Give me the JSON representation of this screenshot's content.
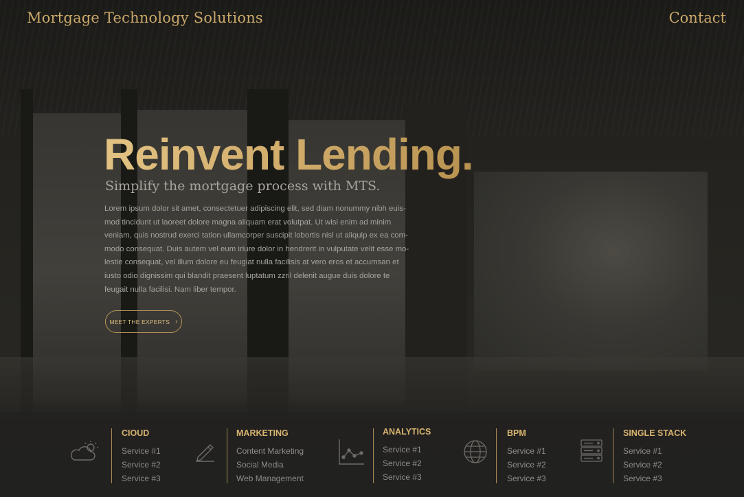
{
  "header": {
    "brand": "Mortgage Technology Solutions",
    "contact_label": "Contact"
  },
  "hero": {
    "headline": "Reinvent Lending.",
    "subhead": "Simplify the mortgage process with MTS.",
    "body": "Lorem ipsum dolor sit amet, consectetuer adipiscing elit, sed diam nonummy nibh euis-mod tincidunt ut laoreet dolore magna aliquam erat volutpat. Ut wisi enim ad minim veniam, quis nostrud exerci tation ullamcorper suscipit lobortis nisl ut aliquip ex ea com-modo consequat. Duis autem vel eum iriure dolor in hendrerit in vulputate velit esse mo-lestie consequat, vel illum dolore eu feugiat nulla facilisis at vero eros et accumsan et iusto odio dignissim qui blandit praesent luptatum zzril delenit augue duis dolore te feugait nulla facilisi. Nam liber tempor.",
    "cta_label": "MEET THE EXPERTS",
    "cta_icon": "chevron-right-icon"
  },
  "services": [
    {
      "title": "CIOUD",
      "icon": "cloud-sun-icon",
      "items": [
        "Service #1",
        "Service #2",
        "Service #3"
      ]
    },
    {
      "title": "MARKETING",
      "icon": "pen-icon",
      "items": [
        "Content Marketing",
        "Social Media",
        "Web Management"
      ]
    },
    {
      "title": "ANALYTICS",
      "icon": "line-chart-icon",
      "items": [
        "Service #1",
        "Service #2",
        "Service #3"
      ]
    },
    {
      "title": "BPM",
      "icon": "globe-icon",
      "items": [
        "Service #1",
        "Service #2",
        "Service #3"
      ]
    },
    {
      "title": "SINGLE STACK",
      "icon": "server-icon",
      "items": [
        "Service #1",
        "Service #2",
        "Service #3"
      ]
    }
  ],
  "colors": {
    "accent": "#c9a86a",
    "body_text": "#a6a39c",
    "service_text": "#8f8c86",
    "bar_background": "#222221"
  }
}
